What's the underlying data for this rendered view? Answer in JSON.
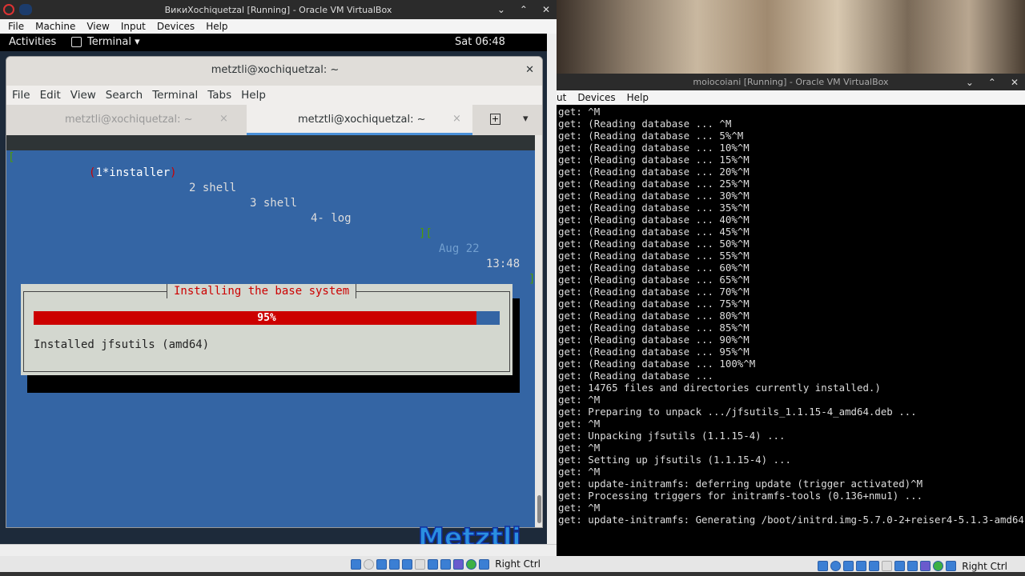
{
  "left_vm": {
    "title": "ВикиXochiquetzal [Running] - Oracle VM VirtualBox",
    "menu": [
      "File",
      "Machine",
      "View",
      "Input",
      "Devices",
      "Help"
    ],
    "host_key": "Right Ctrl"
  },
  "gnome": {
    "activities": "Activities",
    "app_menu": "Terminal ▾",
    "clock": "Sat 06:48"
  },
  "terminal": {
    "title": "metztli@xochiquetzal: ~",
    "menu": [
      "File",
      "Edit",
      "View",
      "Search",
      "Terminal",
      "Tabs",
      "Help"
    ],
    "tabs": [
      {
        "label": "metztli@xochiquetzal: ~",
        "active": false
      },
      {
        "label": "metztli@xochiquetzal: ~",
        "active": true
      }
    ]
  },
  "screen": {
    "bracket_l": "[",
    "windows": [
      {
        "label": "(1*installer)",
        "active": true
      },
      {
        "label": "2 shell"
      },
      {
        "label": "3 shell"
      },
      {
        "label": "4- log"
      }
    ],
    "bracket_r": "][",
    "date": "Aug 22",
    "time": "13:48",
    "bracket_end": "]"
  },
  "installer": {
    "title": "Installing the base system",
    "progress_percent": 95,
    "progress_label": "95%",
    "status": "Installed jfsutils (amd64)",
    "bar_color": "#cc0000",
    "bg_color": "#3465a4"
  },
  "watermark": "Metztli IT",
  "right_vm": {
    "title": "moiocoiani [Running] - Oracle VM VirtualBox",
    "menu": [
      "ut",
      "Devices",
      "Help"
    ],
    "host_key": "Right Ctrl",
    "lines": [
      "get: ^M",
      "get: (Reading database ... ^M",
      "get: (Reading database ... 5%^M",
      "get: (Reading database ... 10%^M",
      "get: (Reading database ... 15%^M",
      "get: (Reading database ... 20%^M",
      "get: (Reading database ... 25%^M",
      "get: (Reading database ... 30%^M",
      "get: (Reading database ... 35%^M",
      "get: (Reading database ... 40%^M",
      "get: (Reading database ... 45%^M",
      "get: (Reading database ... 50%^M",
      "get: (Reading database ... 55%^M",
      "get: (Reading database ... 60%^M",
      "get: (Reading database ... 65%^M",
      "get: (Reading database ... 70%^M",
      "get: (Reading database ... 75%^M",
      "get: (Reading database ... 80%^M",
      "get: (Reading database ... 85%^M",
      "get: (Reading database ... 90%^M",
      "get: (Reading database ... 95%^M",
      "get: (Reading database ... 100%^M",
      "get: (Reading database ... ",
      "get: 14765 files and directories currently installed.)",
      "get: ^M",
      "get: Preparing to unpack .../jfsutils_1.1.15-4_amd64.deb ...",
      "get: ^M",
      "get: Unpacking jfsutils (1.1.15-4) ...",
      "get: ^M",
      "get: Setting up jfsutils (1.1.15-4) ...",
      "get: ^M",
      "get: update-initramfs: deferring update (trigger activated)^M",
      "get: Processing triggers for initramfs-tools (0.136+nmu1) ...",
      "get: ^M",
      "get: update-initramfs: Generating /boot/initrd.img-5.7.0-2+reiser4-5.1.3-amd64"
    ]
  }
}
